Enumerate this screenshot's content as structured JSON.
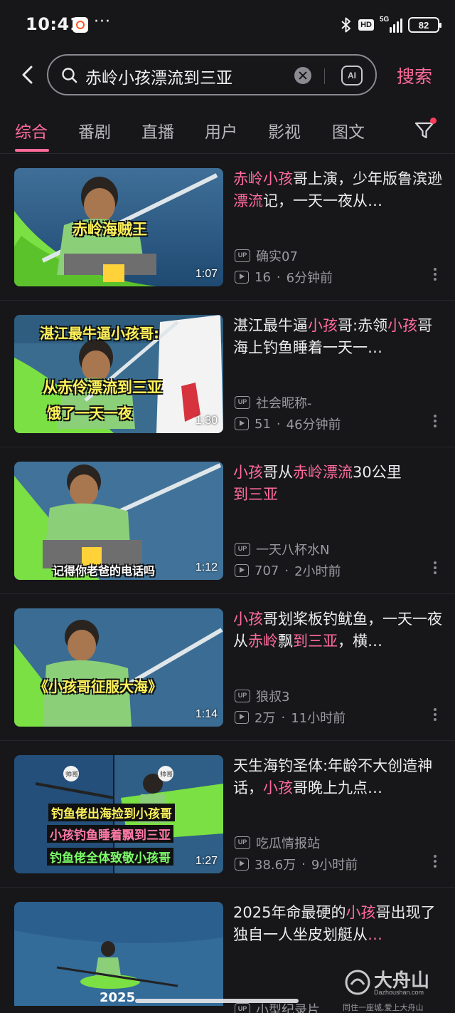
{
  "status_bar": {
    "time": "10:41",
    "more": "···",
    "hd": "HD",
    "network": "5G",
    "battery": "82"
  },
  "search": {
    "query": "赤岭小孩漂流到三亚",
    "ai_label": "AI",
    "button": "搜索"
  },
  "tabs": [
    {
      "label": "综合",
      "active": true
    },
    {
      "label": "番剧",
      "active": false
    },
    {
      "label": "直播",
      "active": false
    },
    {
      "label": "用户",
      "active": false
    },
    {
      "label": "影视",
      "active": false
    },
    {
      "label": "图文",
      "active": false
    }
  ],
  "colors": {
    "accent": "#ff6b9a",
    "background": "#17171a",
    "meta": "#9a9aa0"
  },
  "videos": [
    {
      "title_parts": [
        {
          "text": "赤岭小孩",
          "hl": true
        },
        {
          "text": "哥上演，少年版鲁滨逊",
          "hl": false
        },
        {
          "text": "漂流",
          "hl": true
        },
        {
          "text": "记，一天一夜从…",
          "hl": false
        }
      ],
      "uploader": "确实07",
      "views": "16",
      "sep": "·",
      "time": "6分钟前",
      "duration": "1:07",
      "captions": [
        "赤岭海贼王"
      ]
    },
    {
      "title_parts": [
        {
          "text": "湛江最牛逼",
          "hl": false
        },
        {
          "text": "小孩",
          "hl": true
        },
        {
          "text": "哥:赤领",
          "hl": false
        },
        {
          "text": "小孩",
          "hl": true
        },
        {
          "text": "哥海上钓鱼睡着一天一…",
          "hl": false
        }
      ],
      "uploader": "社会昵称-",
      "views": "51",
      "sep": "·",
      "time": "46分钟前",
      "duration": "1:30",
      "captions": [
        "湛江最牛逼小孩哥:",
        "从赤伶漂流到三亚",
        "饿了一天一夜"
      ]
    },
    {
      "title_parts": [
        {
          "text": "小孩",
          "hl": true
        },
        {
          "text": "哥从",
          "hl": false
        },
        {
          "text": "赤岭漂流",
          "hl": true
        },
        {
          "text": "30公里",
          "hl": false
        },
        {
          "text": "到三亚",
          "hl": true
        }
      ],
      "uploader": "一天八杯水N",
      "views": "707",
      "sep": "·",
      "time": "2小时前",
      "duration": "1:12",
      "captions": [
        "记得你老爸的电话吗"
      ]
    },
    {
      "title_parts": [
        {
          "text": "小孩",
          "hl": true
        },
        {
          "text": "哥划桨板钓鱿鱼，一天一夜从",
          "hl": false
        },
        {
          "text": "赤岭",
          "hl": true
        },
        {
          "text": "飘",
          "hl": false
        },
        {
          "text": "到三亚",
          "hl": true
        },
        {
          "text": "，横…",
          "hl": false
        }
      ],
      "uploader": "狼叔3",
      "views": "2万",
      "sep": "·",
      "time": "11小时前",
      "duration": "1:14",
      "captions": [
        "《小孩哥征服大海》"
      ]
    },
    {
      "title_parts": [
        {
          "text": "天生海钓圣体:年龄不大创造神话，",
          "hl": false
        },
        {
          "text": "小孩",
          "hl": true
        },
        {
          "text": "哥晚上九点…",
          "hl": false
        }
      ],
      "uploader": "吃瓜情报站",
      "views": "38.6万",
      "sep": "·",
      "time": "9小时前",
      "duration": "1:27",
      "captions": [
        "钓鱼佬出海捡到小孩哥",
        "小孩钓鱼睡着飘到三亚",
        "钓鱼佬全体致敬小孩哥"
      ],
      "stickers": [
        "帅哥",
        "帅哥"
      ]
    },
    {
      "title_parts": [
        {
          "text": "2025年命最硬的",
          "hl": false
        },
        {
          "text": "小孩",
          "hl": true
        },
        {
          "text": "哥出现了独自一人坐皮划艇从",
          "hl": false
        },
        {
          "text": "…",
          "hl": true
        }
      ],
      "uploader": "小型纪录片",
      "views": "",
      "sep": "",
      "time": "",
      "duration": "",
      "captions": [
        "2025"
      ]
    }
  ],
  "watermark": {
    "name": "大舟山",
    "domain": "Dazhoushan.com",
    "tagline": "同住一座城,爱上大舟山"
  }
}
